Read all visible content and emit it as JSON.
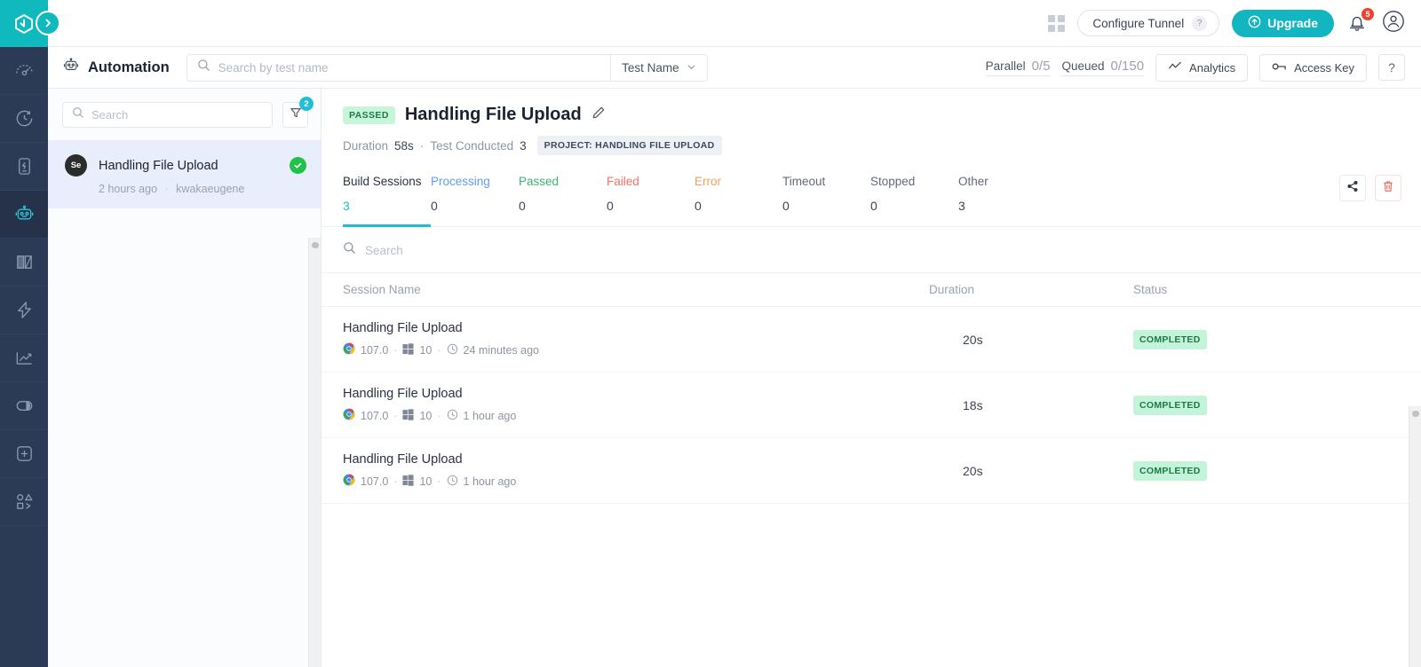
{
  "brand": {
    "accent": "#12b5c0",
    "rail_bg": "#2b3a55",
    "logo_name": "lambdatest-logo"
  },
  "rail": {
    "items": [
      {
        "name": "dashboard-speedometer-icon",
        "active": false
      },
      {
        "name": "realtime-clock-icon",
        "active": false
      },
      {
        "name": "app-testing-icon",
        "active": false
      },
      {
        "name": "automation-robot-icon",
        "active": true
      },
      {
        "name": "visual-regression-icon",
        "active": false
      },
      {
        "name": "hyperexecute-bolt-icon",
        "active": false
      },
      {
        "name": "analytics-chart-icon",
        "active": false
      },
      {
        "name": "smart-ui-icon",
        "active": false
      },
      {
        "name": "add-new-icon",
        "active": false
      },
      {
        "name": "integrations-icon",
        "active": false
      }
    ]
  },
  "topbar": {
    "grid_icon": "app-switcher-icon",
    "configure_tunnel_label": "Configure Tunnel",
    "tunnel_help": "?",
    "upgrade_label": "Upgrade",
    "notification_count": "5",
    "bell_icon": "notification-bell-icon",
    "avatar_icon": "user-avatar-icon"
  },
  "subheader": {
    "module_title": "Automation",
    "module_icon": "robot-icon",
    "search_placeholder": "Search by test name",
    "search_value": "",
    "filter_select": "Test Name",
    "parallel_label": "Parallel",
    "parallel_value": "0/5",
    "queued_label": "Queued",
    "queued_value": "0/150",
    "analytics_label": "Analytics",
    "access_key_label": "Access Key",
    "help_label": "?"
  },
  "list_panel": {
    "search_placeholder": "Search",
    "search_value": "",
    "filter_badge": "2",
    "items": [
      {
        "framework_logo": "Se",
        "name": "Handling File Upload",
        "time": "2 hours ago",
        "user": "kwakaeugene",
        "status": "passed"
      }
    ]
  },
  "build": {
    "status_chip": "PASSED",
    "title": "Handling File Upload",
    "duration_label": "Duration",
    "duration_value": "58s",
    "tests_label": "Test Conducted",
    "tests_value": "3",
    "project_chip": "PROJECT: HANDLING FILE UPLOAD",
    "tabs": [
      {
        "label": "Build Sessions",
        "value": "3",
        "state": "active"
      },
      {
        "label": "Processing",
        "value": "0",
        "state": "processing"
      },
      {
        "label": "Passed",
        "value": "0",
        "state": "passed"
      },
      {
        "label": "Failed",
        "value": "0",
        "state": "failed"
      },
      {
        "label": "Error",
        "value": "0",
        "state": "error"
      },
      {
        "label": "Timeout",
        "value": "0",
        "state": "plain"
      },
      {
        "label": "Stopped",
        "value": "0",
        "state": "plain"
      },
      {
        "label": "Other",
        "value": "3",
        "state": "plain"
      }
    ],
    "share_icon": "share-icon",
    "delete_icon": "trash-icon"
  },
  "table": {
    "search_placeholder": "Search",
    "search_value": "",
    "headers": {
      "name": "Session Name",
      "duration": "Duration",
      "status": "Status"
    },
    "rows": [
      {
        "name": "Handling File Upload",
        "browser_icon": "chrome-icon",
        "browser_version": "107.0",
        "os_icon": "windows-icon",
        "os_version": "10",
        "clock_icon": "clock-icon",
        "time": "24 minutes ago",
        "duration": "20s",
        "status": "COMPLETED"
      },
      {
        "name": "Handling File Upload",
        "browser_icon": "chrome-icon",
        "browser_version": "107.0",
        "os_icon": "windows-icon",
        "os_version": "10",
        "clock_icon": "clock-icon",
        "time": "1 hour ago",
        "duration": "18s",
        "status": "COMPLETED"
      },
      {
        "name": "Handling File Upload",
        "browser_icon": "chrome-icon",
        "browser_version": "107.0",
        "os_icon": "windows-icon",
        "os_version": "10",
        "clock_icon": "clock-icon",
        "time": "1 hour ago",
        "duration": "20s",
        "status": "COMPLETED"
      }
    ]
  }
}
